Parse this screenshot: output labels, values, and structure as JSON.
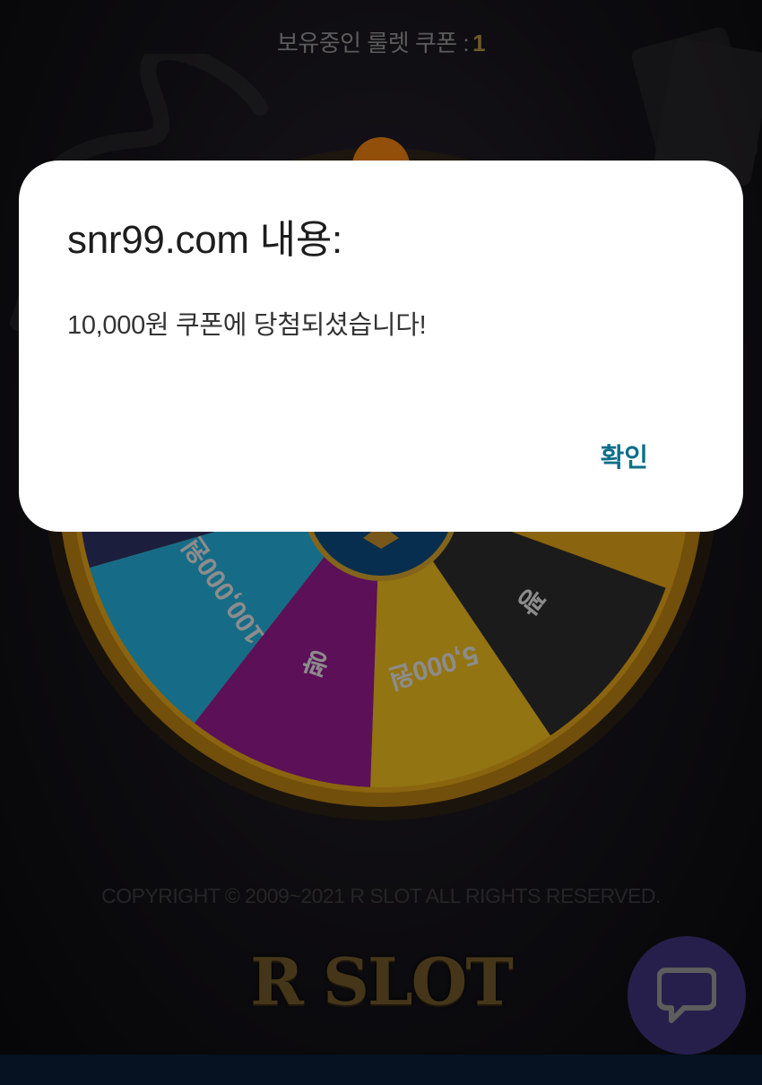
{
  "header": {
    "coupon_label": "보유중인 룰렛 쿠폰 :",
    "coupon_count": "1"
  },
  "roulette": {
    "segments": [
      {
        "label": "꽝",
        "color": "#2b2f5e"
      },
      {
        "label": "100,000원",
        "color": "#23a7cf"
      },
      {
        "label": "꽝",
        "color": "#8d1a86"
      },
      {
        "label": "5,000원",
        "color": "#e0b21d"
      },
      {
        "label": "꽝",
        "color": "#2a2a2a"
      }
    ],
    "rim_color": "#e2a11e"
  },
  "footer": {
    "copyright": "COPYRIGHT © 2009~2021 R SLOT ALL RIGHTS RESERVED.",
    "logo_text": "R SLOT"
  },
  "chat": {
    "icon": "chat-bubble-icon",
    "color": "#3c3073"
  },
  "dialog": {
    "title": "snr99.com 내용:",
    "message": "10,000원 쿠폰에 당첨되셨습니다!",
    "confirm_label": "확인"
  }
}
